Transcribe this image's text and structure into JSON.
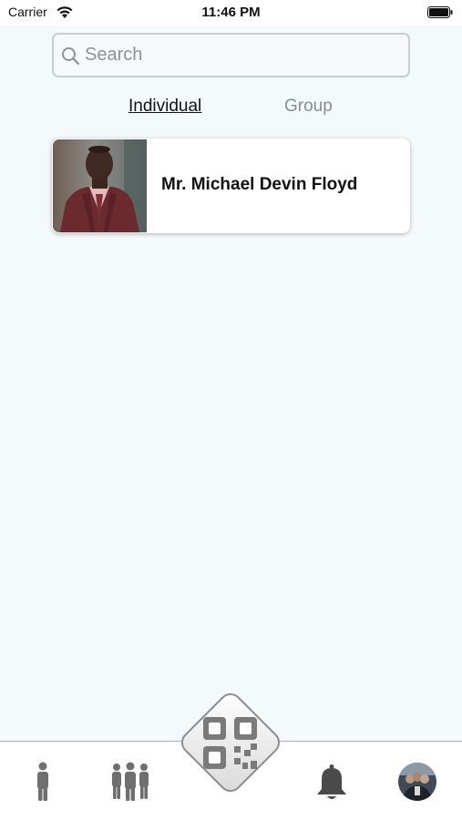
{
  "status_bar": {
    "carrier": "Carrier",
    "time": "11:46 PM"
  },
  "search": {
    "placeholder": "Search",
    "value": ""
  },
  "tabs": {
    "individual": "Individual",
    "group": "Group"
  },
  "contacts": [
    {
      "name": "Mr. Michael Devin Floyd"
    }
  ],
  "tab_bar": {
    "icons": [
      "person-icon",
      "group-icon",
      "qr-code-icon",
      "bell-icon",
      "profile-avatar"
    ]
  },
  "colors": {
    "background": "#f4f9fc",
    "tab_icon": "#6f6f6f",
    "active_tab_text": "#111111",
    "inactive_tab_text": "#8a8d90"
  }
}
